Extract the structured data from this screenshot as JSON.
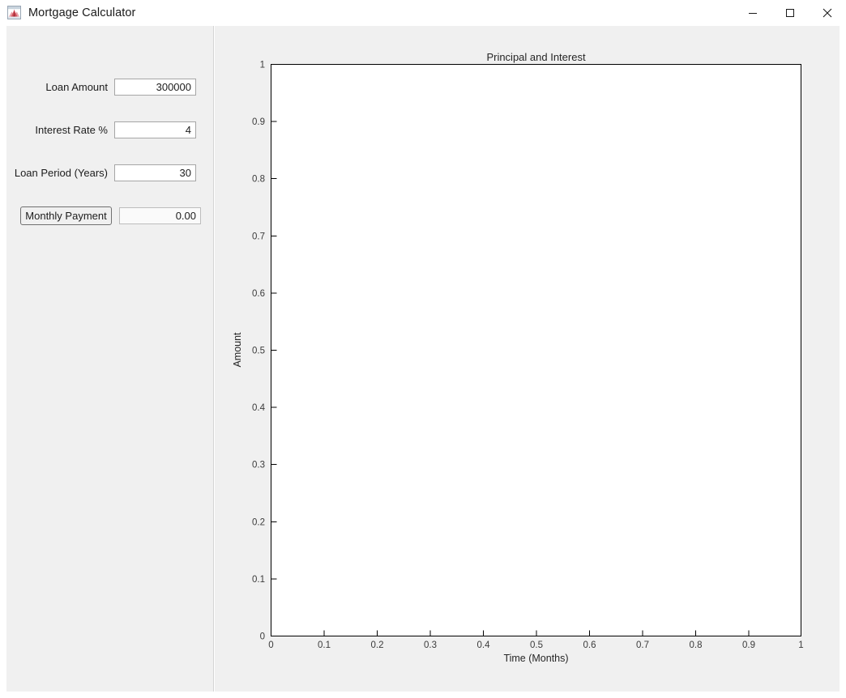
{
  "window": {
    "title": "Mortgage Calculator",
    "icon": "matlab-membrane-icon",
    "controls": {
      "minimize": "minimize-icon",
      "maximize": "maximize-icon",
      "close": "close-icon"
    }
  },
  "form": {
    "fields": [
      {
        "label": "Loan Amount",
        "value": "300000"
      },
      {
        "label": "Interest Rate %",
        "value": "4"
      },
      {
        "label": "Loan Period (Years)",
        "value": "30"
      }
    ],
    "action": {
      "button_label": "Monthly Payment",
      "result_value": "0.00"
    }
  },
  "chart_data": {
    "type": "line",
    "title": "Principal and Interest",
    "xlabel": "Time (Months)",
    "ylabel": "Amount",
    "xlim": [
      0,
      1
    ],
    "ylim": [
      0,
      1
    ],
    "xticks": [
      "0",
      "0.1",
      "0.2",
      "0.3",
      "0.4",
      "0.5",
      "0.6",
      "0.7",
      "0.8",
      "0.9",
      "1"
    ],
    "yticks": [
      "0",
      "0.1",
      "0.2",
      "0.3",
      "0.4",
      "0.5",
      "0.6",
      "0.7",
      "0.8",
      "0.9",
      "1"
    ],
    "grid": false,
    "legend": null,
    "series": [],
    "x": [],
    "values": [],
    "note": "empty axes - no data plotted"
  },
  "colors": {
    "panel_bg": "#f0f0f0",
    "plot_bg": "#ffffff",
    "axis": "#000000",
    "title_bar_bg": "#ffffff",
    "input_bg": "#ffffff",
    "input_border": "#a6a6a6"
  }
}
